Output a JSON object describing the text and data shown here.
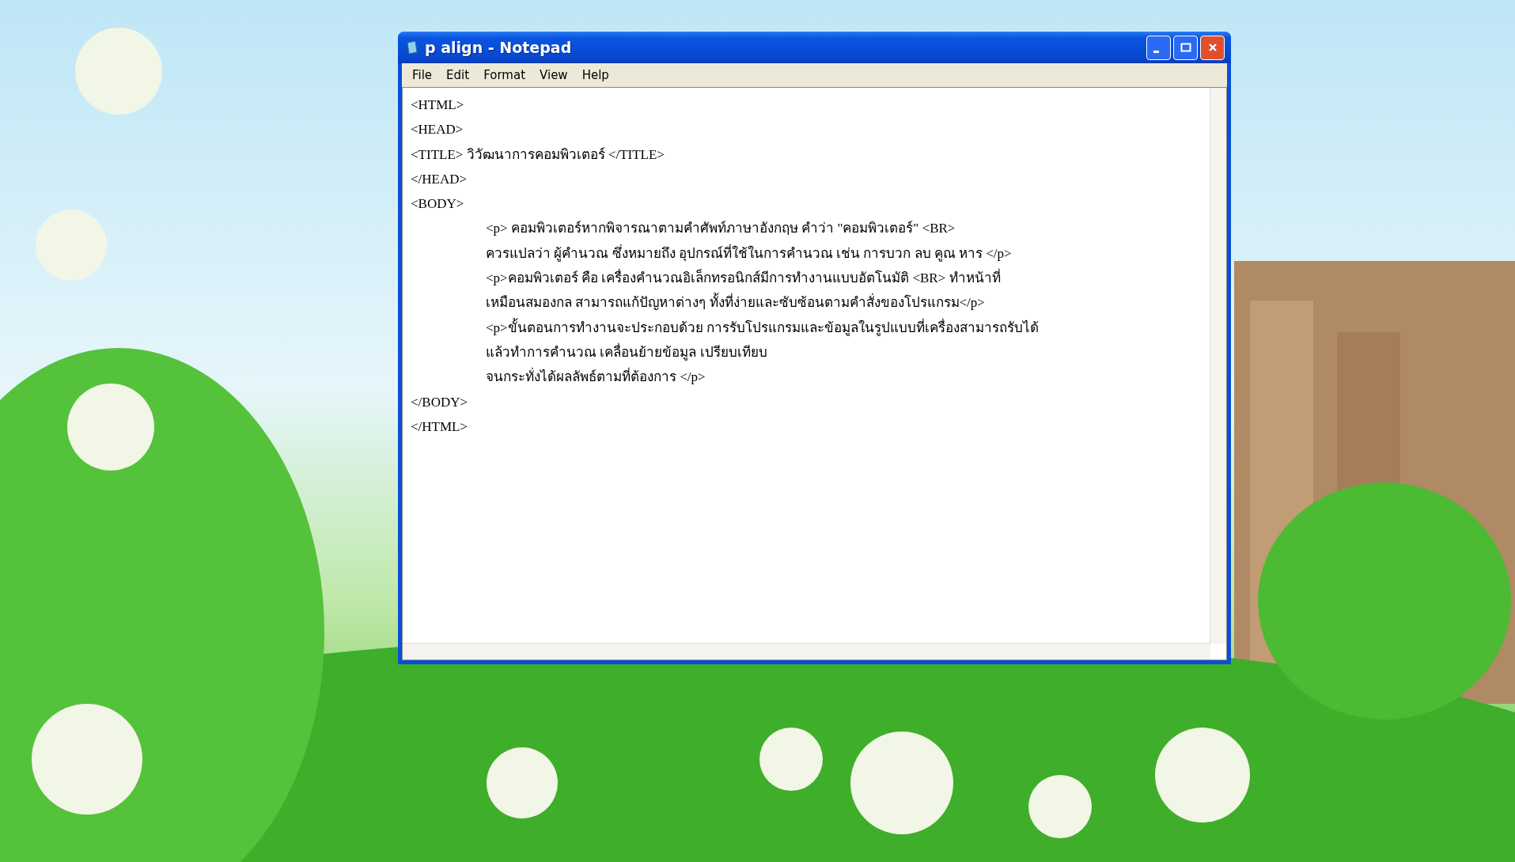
{
  "window": {
    "title": "p align - Notepad",
    "active": true
  },
  "menu": [
    "File",
    "Edit",
    "Format",
    "View",
    "Help"
  ],
  "lines": [
    {
      "text": "<HTML>",
      "indented": false
    },
    {
      "text": "<HEAD>",
      "indented": false
    },
    {
      "text": "<TITLE> วิวัฒนาการคอมพิวเตอร์ </TITLE>",
      "indented": false
    },
    {
      "text": "</HEAD>",
      "indented": false
    },
    {
      "text": "<BODY>",
      "indented": false
    },
    {
      "text": "<p> คอมพิวเตอร์หากพิจารณาตามคำศัพท์ภาษาอังกฤษ คำว่า \"คอมพิวเตอร์\" <BR>",
      "indented": true
    },
    {
      "text": "ควรแปลว่า ผู้คำนวณ ซึ่งหมายถึง อุปกรณ์ที่ใช้ในการคำนวณ เช่น การบวก ลบ คูณ หาร </p>",
      "indented": true
    },
    {
      "text": "<p>คอมพิวเตอร์ คือ เครื่องคำนวณอิเล็กทรอนิกส์มีการทำงานแบบอัตโนมัติ <BR> ทำหน้าที่",
      "indented": true
    },
    {
      "text": "เหมือนสมองกล สามารถแก้ปัญหาต่างๆ ทั้งที่ง่ายและซับซ้อนตามคำสั่งของโปรแกรม</p>",
      "indented": true
    },
    {
      "text": "<p>ขั้นตอนการทำงานจะประกอบด้วย การรับโปรแกรมและข้อมูลในรูปแบบที่เครื่องสามารถรับได้",
      "indented": true
    },
    {
      "text": "แล้วทำการคำนวณ เคลื่อนย้ายข้อมูล เปรียบเทียบ",
      "indented": true
    },
    {
      "text": "จนกระทั่งได้ผลลัพธ์ตามที่ต้องการ </p>",
      "indented": true
    },
    {
      "text": "</BODY>",
      "indented": false
    },
    {
      "text": "</HTML>",
      "indented": false
    }
  ]
}
